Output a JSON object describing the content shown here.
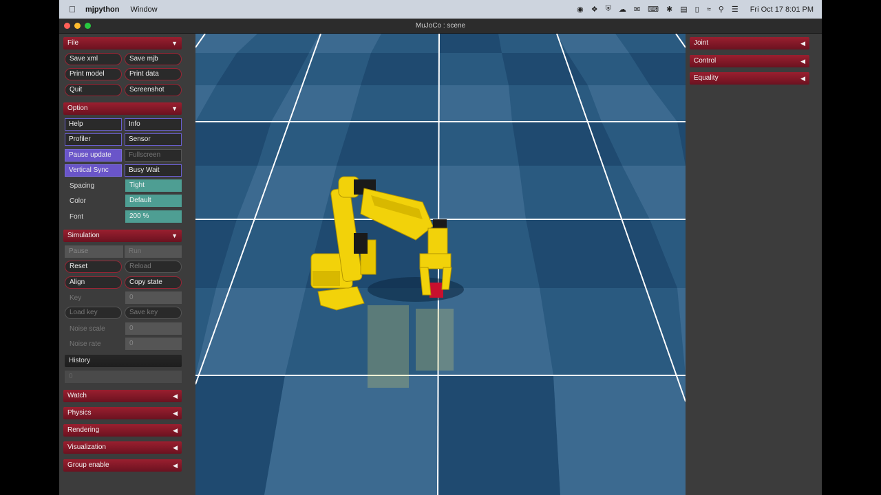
{
  "menubar": {
    "app_name": "mjpython",
    "menus": [
      "Window"
    ],
    "clock": "Fri Oct 17  8:01 PM"
  },
  "window": {
    "title": "MuJoCo : scene"
  },
  "left": {
    "file": {
      "header": "File",
      "save_xml": "Save xml",
      "save_mjb": "Save mjb",
      "print_model": "Print model",
      "print_data": "Print data",
      "quit": "Quit",
      "screenshot": "Screenshot"
    },
    "option": {
      "header": "Option",
      "help": "Help",
      "info": "Info",
      "profiler": "Profiler",
      "sensor": "Sensor",
      "pause_update": "Pause update",
      "fullscreen": "Fullscreen",
      "vertical_sync": "Vertical Sync",
      "busy_wait": "Busy Wait",
      "spacing_label": "Spacing",
      "spacing_value": "Tight",
      "color_label": "Color",
      "color_value": "Default",
      "font_label": "Font",
      "font_value": "200 %"
    },
    "simulation": {
      "header": "Simulation",
      "pause": "Pause",
      "run": "Run",
      "reset": "Reset",
      "reload": "Reload",
      "align": "Align",
      "copy_state": "Copy state",
      "key_label": "Key",
      "key_value": "0",
      "load_key": "Load key",
      "save_key": "Save key",
      "noise_scale_label": "Noise scale",
      "noise_scale_value": "0",
      "noise_rate_label": "Noise rate",
      "noise_rate_value": "0",
      "history_label": "History",
      "history_value": "0"
    },
    "collapsed": [
      "Watch",
      "Physics",
      "Rendering",
      "Visualization",
      "Group enable"
    ]
  },
  "right": {
    "collapsed": [
      "Joint",
      "Control",
      "Equality"
    ]
  },
  "colors": {
    "section_red": "#9a1f2f",
    "checkbox_on": "#6a55c9",
    "select_teal": "#4e9e93",
    "floor_dark": "#1f4a70",
    "floor_light": "#3c6a90",
    "robot_yellow": "#f2d20a"
  }
}
